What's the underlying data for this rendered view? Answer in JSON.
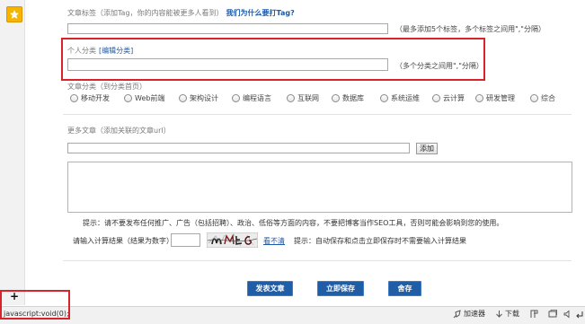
{
  "left_panel": {
    "star_icon": "star-icon",
    "add_symbol": "+"
  },
  "tags": {
    "label": "文章标签（添加Tag，你的内容能被更多人看到）",
    "link": "我们为什么要打Tag?",
    "value": "",
    "hint": "（最多添加5个标签，多个标签之间用\",\"分隔）"
  },
  "personal_category": {
    "label": "个人分类",
    "edit_link": "[编辑分类]",
    "value": "",
    "hint": "（多个分类之间用\",\"分隔）"
  },
  "article_category": {
    "label": "文章分类（到分类首页）",
    "options": [
      "移动开发",
      "Web前端",
      "架构设计",
      "编程语言",
      "互联网",
      "数据库",
      "系统运维",
      "云计算",
      "研发管理",
      "综合"
    ]
  },
  "more_articles": {
    "label": "更多文章（添加关联的文章url）",
    "url_value": "",
    "add_button": "添加",
    "textarea_value": ""
  },
  "notice": "提示：请不要发布任何推广、广告（包括招聘）、政治、低俗等方面的内容，不要把博客当作SEO工具，否则可能会影响到您的使用。",
  "captcha": {
    "label": "请输入计算结果（结果为数字）",
    "value": "",
    "refresh_link": "看不清",
    "hint": "提示：自动保存和点击立即保存时不需要输入计算结果"
  },
  "actions": {
    "publish": "发表文章",
    "save": "立即保存",
    "discard": "舍存"
  },
  "status_bar": {
    "url": "javascript:void(0);",
    "accelerator": "加速器",
    "download": "下载",
    "icons": [
      "accelerator-icon",
      "download-icon",
      "panel-icon",
      "window-icon",
      "volume-icon",
      "return-icon"
    ]
  },
  "colors": {
    "link": "#1d5aa8",
    "button": "#1f5da6",
    "highlight_box": "#d9232b",
    "star": "#f4b400"
  }
}
